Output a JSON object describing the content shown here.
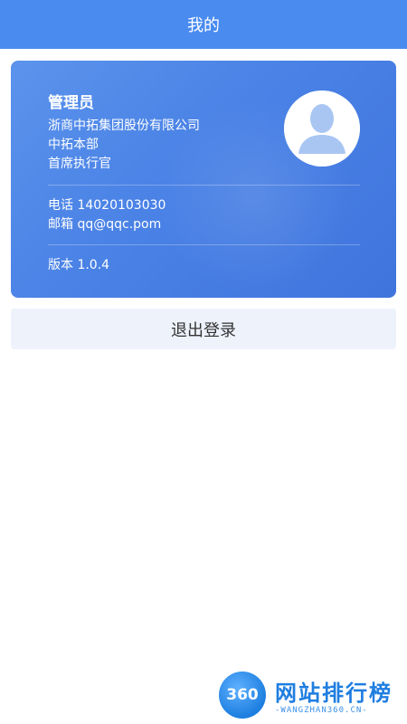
{
  "header": {
    "title": "我的"
  },
  "profile": {
    "name": "管理员",
    "company": "浙商中拓集团股份有限公司",
    "department": "中拓本部",
    "position": "首席执行官",
    "phone": "电话 14020103030",
    "email": "邮箱 qq@qqc.pom",
    "version": "版本 1.0.4",
    "avatar_icon": "user-avatar-icon"
  },
  "actions": {
    "logout_label": "退出登录"
  },
  "watermark": {
    "badge": "360",
    "title": "网站排行榜",
    "subtitle": "-WANGZHAN360.CN-"
  },
  "colors": {
    "header": "#4a8bf0",
    "card": "#4a82e6",
    "button_bg": "#eef2fb",
    "avatar_silhouette": "#a9c6f3"
  }
}
